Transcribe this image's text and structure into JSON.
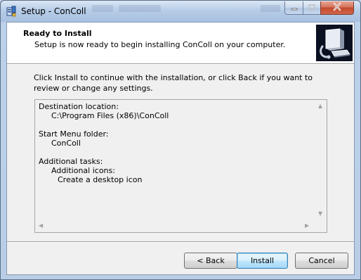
{
  "window": {
    "title": "Setup - ConColl"
  },
  "header": {
    "title": "Ready to Install",
    "subtitle": "Setup is now ready to begin installing ConColl on your computer."
  },
  "intro_text": "Click Install to continue with the installation, or click Back if you want to review or change any settings.",
  "memo": {
    "lines": [
      {
        "text": "Destination location:",
        "level": 1
      },
      {
        "text": "C:\\Program Files (x86)\\ConColl",
        "level": 2
      },
      {
        "text": "",
        "level": 0
      },
      {
        "text": "Start Menu folder:",
        "level": 1
      },
      {
        "text": "ConColl",
        "level": 2
      },
      {
        "text": "",
        "level": 0
      },
      {
        "text": "Additional tasks:",
        "level": 1
      },
      {
        "text": "Additional icons:",
        "level": 2
      },
      {
        "text": "Create a desktop icon",
        "level": 3
      }
    ]
  },
  "buttons": {
    "back": "< Back",
    "install": "Install",
    "cancel": "Cancel"
  },
  "icons": {
    "app": "setup-icon",
    "wizard": "computer-install-icon",
    "minimize": "minimize-icon",
    "maximize": "maximize-icon",
    "close": "close-icon"
  },
  "colors": {
    "close_button": "#c24a2d",
    "default_button_border": "#3c7fb1",
    "header_bg": "#ffffff",
    "dialog_bg": "#f0f0f0"
  }
}
